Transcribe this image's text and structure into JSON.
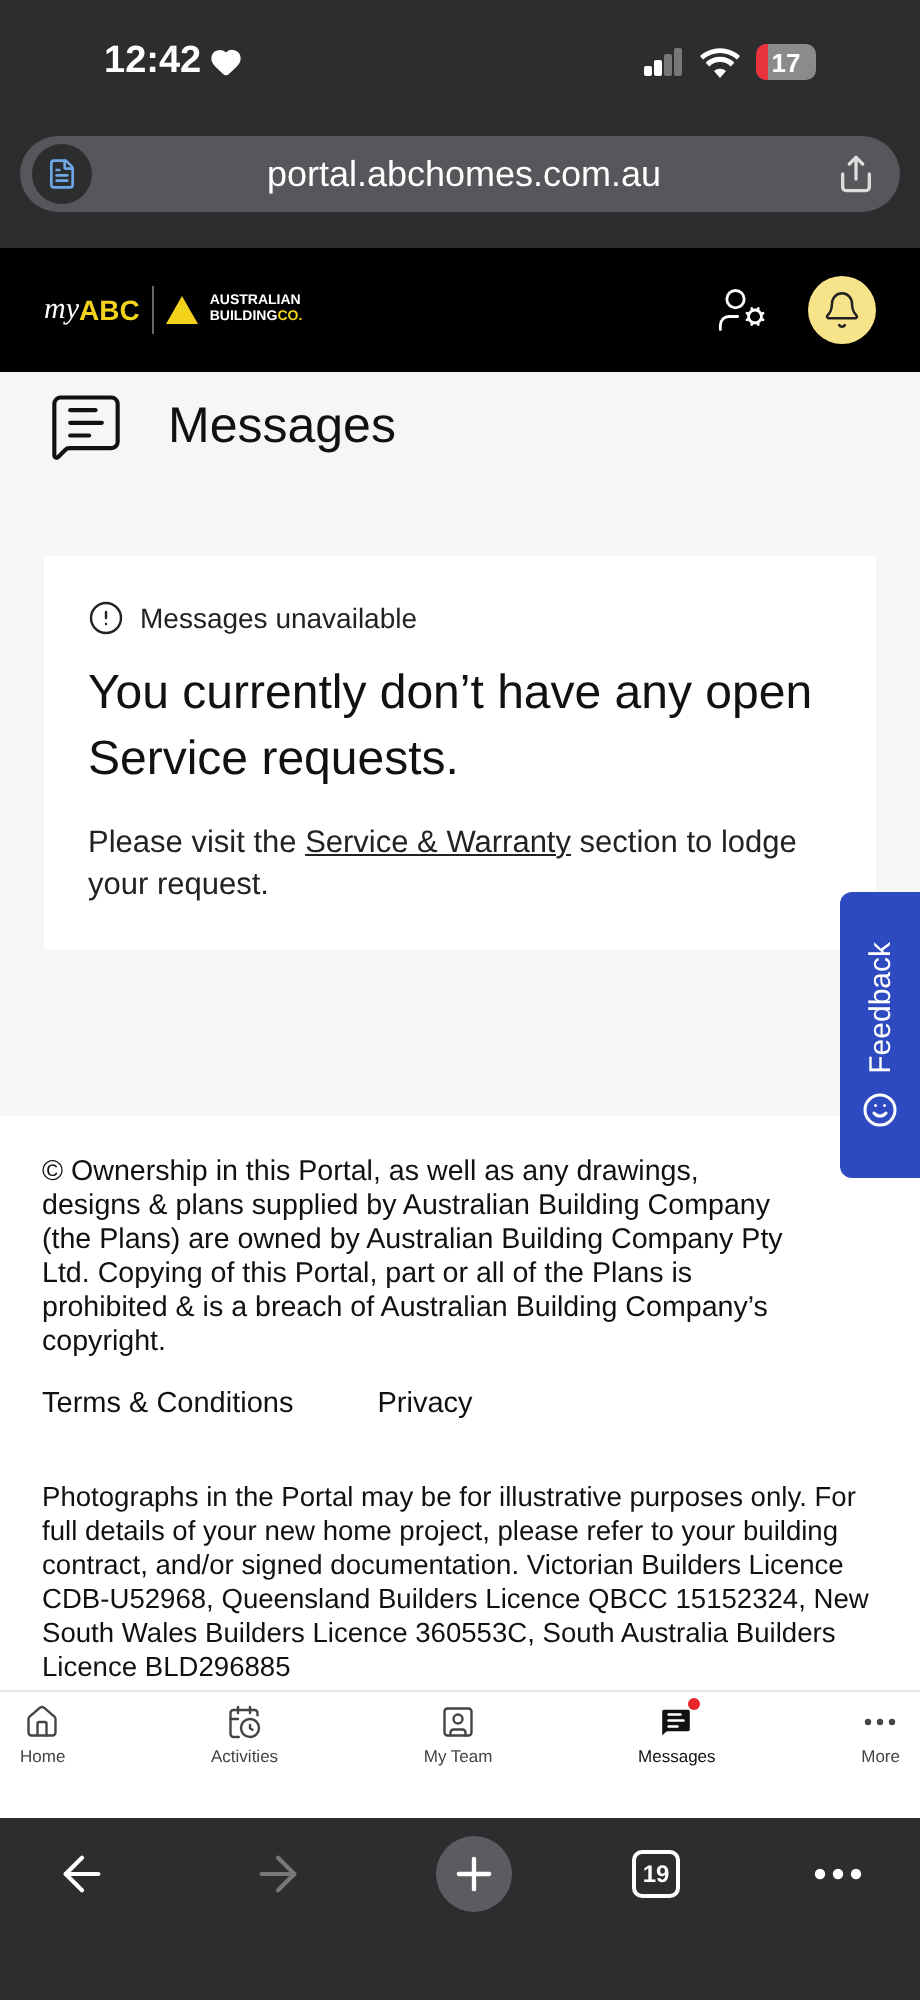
{
  "status_bar": {
    "time": "12:42",
    "battery": "17"
  },
  "address_bar": {
    "url": "portal.abchomes.com.au"
  },
  "header": {
    "logo_script": "my",
    "logo_bold": "ABC",
    "logo_company": [
      "AUSTRALIAN",
      "BUILDING",
      "CO."
    ]
  },
  "page": {
    "title": "Messages"
  },
  "notice": {
    "status": "Messages unavailable",
    "heading": "You currently don’t have any open Service requests.",
    "body_before": "Please visit the ",
    "link": "Service & Warranty",
    "body_after": " section to lodge your request."
  },
  "feedback_tab": {
    "label": "Feedback"
  },
  "footer": {
    "copyright": "© Ownership in this Portal, as well as any drawings, designs & plans supplied by Australian Building Company (the Plans) are owned by Australian Building Company Pty Ltd. Copying of this Portal, part or all of the Plans is prohibited & is a breach of Australian Building Company’s copyright.",
    "links": [
      "Terms & Conditions",
      "Privacy"
    ],
    "disclaimer": "Photographs in the Portal may be for illustrative purposes only. For full details of your new home project, please refer to your building contract, and/or signed documentation. Victorian Builders Licence CDB-U52968, Queensland Builders Licence QBCC 15152324, New South Wales Builders Licence 360553C, South Australia Builders Licence BLD296885"
  },
  "bottom_nav": [
    {
      "kind": "home",
      "label": "Home",
      "selected": false,
      "badge": false
    },
    {
      "kind": "activities",
      "label": "Activities",
      "selected": false,
      "badge": false
    },
    {
      "kind": "team",
      "label": "My Team",
      "selected": false,
      "badge": false
    },
    {
      "kind": "messages",
      "label": "Messages",
      "selected": true,
      "badge": true
    },
    {
      "kind": "more",
      "label": "More",
      "selected": false,
      "badge": false
    }
  ],
  "browser_toolbar": {
    "back_disabled": false,
    "forward_disabled": true,
    "tab_count": "19"
  }
}
